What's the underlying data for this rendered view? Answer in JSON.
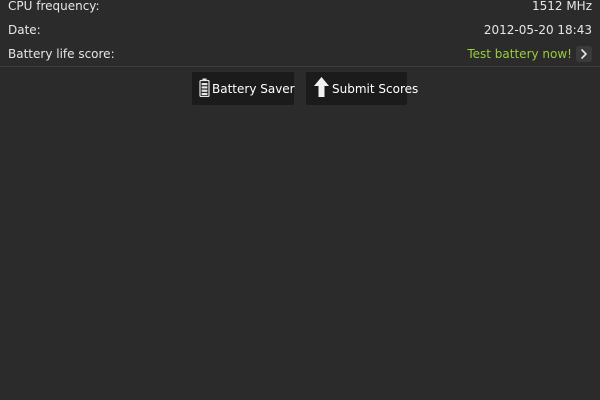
{
  "info": {
    "cpu_label": "CPU frequency:",
    "cpu_value": "1512 MHz",
    "date_label": "Date:",
    "date_value": "2012-05-20 18:43",
    "battery_label": "Battery life score:",
    "battery_link": "Test battery now!"
  },
  "buttons": {
    "battery_saver": "Battery Saver",
    "submit_scores": "Submit Scores"
  },
  "icons": {
    "battery": "battery-icon",
    "upload": "upload-arrow-icon",
    "chevron": "chevron-right-icon"
  },
  "colors": {
    "background": "#2b2b2b",
    "link": "#9ccc3a",
    "button_bg": "#1b1b1b"
  }
}
